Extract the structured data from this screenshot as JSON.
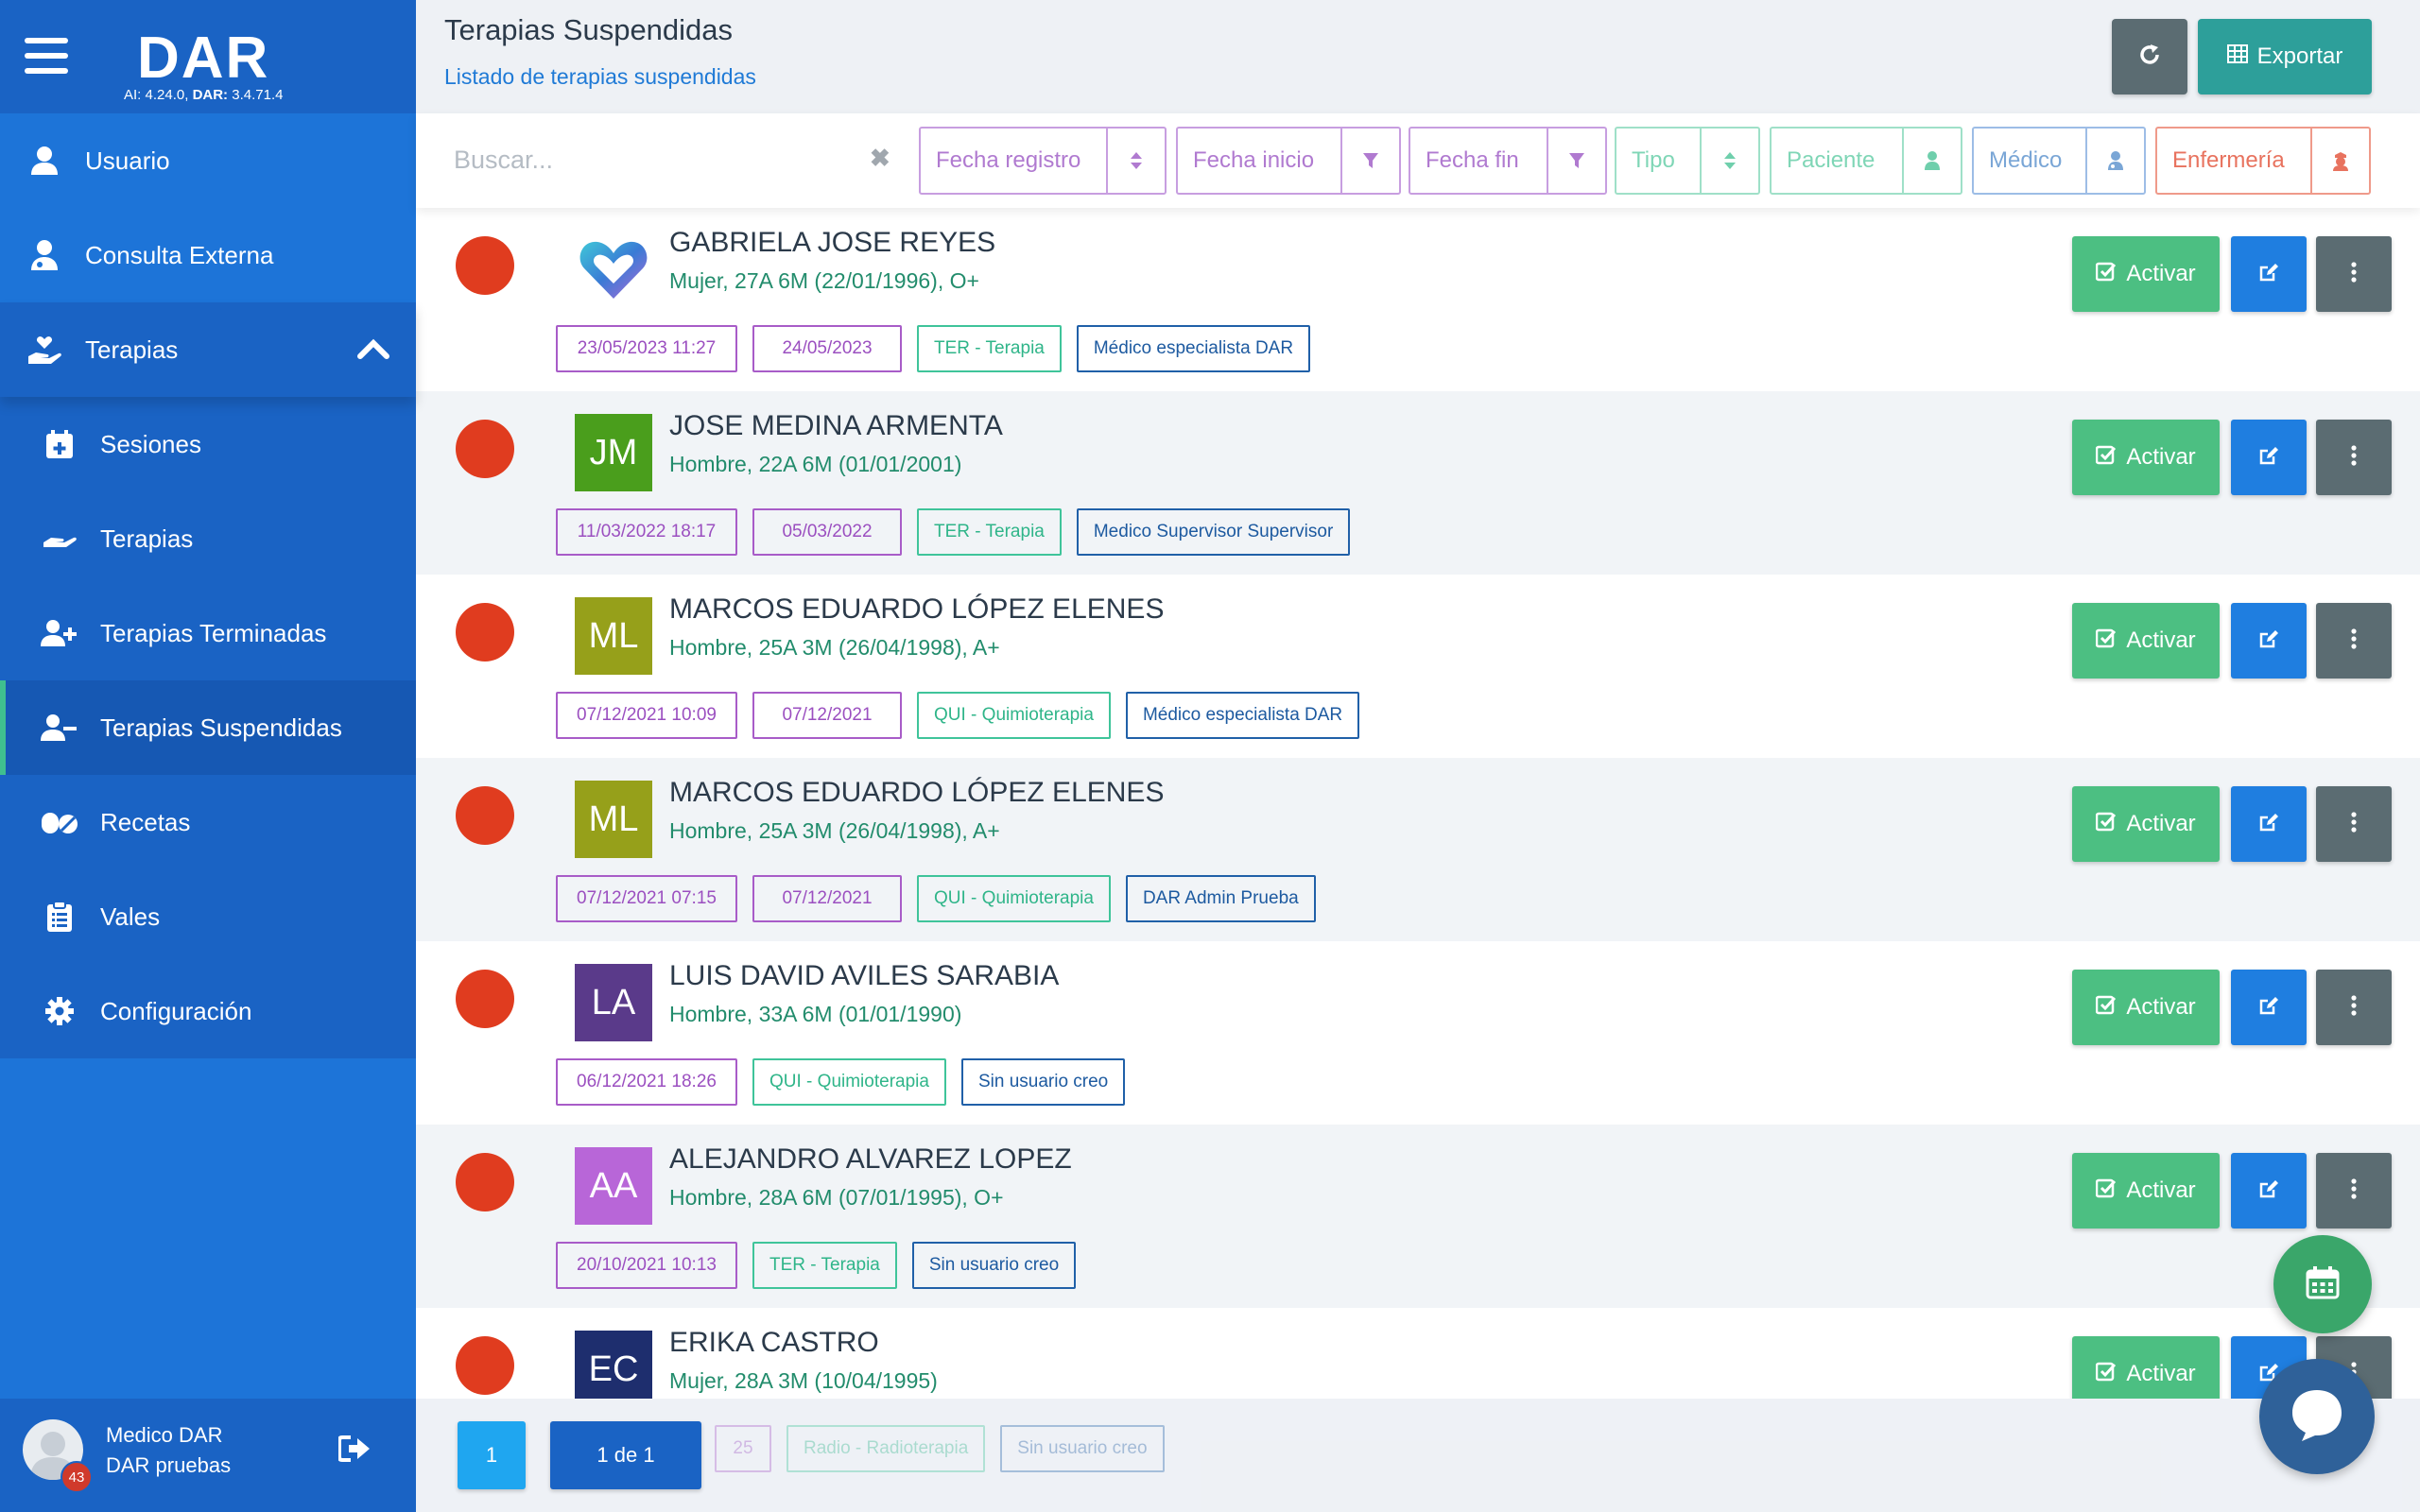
{
  "app": {
    "logo": "DAR",
    "version_ai_label": "AI:",
    "version_ai": "4.24.0,",
    "version_dar_label": "DAR:",
    "version_dar": "3.4.71.4"
  },
  "sidebar": {
    "items": [
      {
        "label": "Usuario",
        "icon": "user-icon"
      },
      {
        "label": "Consulta Externa",
        "icon": "doctor-icon"
      },
      {
        "label": "Terapias",
        "icon": "hand-heart-icon",
        "expanded": true
      },
      {
        "label": "Sesiones",
        "icon": "calendar-plus-icon"
      },
      {
        "label": "Terapias",
        "icon": "hand-icon"
      },
      {
        "label": "Terapias Terminadas",
        "icon": "user-plus-icon"
      },
      {
        "label": "Terapias Suspendidas",
        "icon": "user-minus-icon",
        "active": true
      },
      {
        "label": "Recetas",
        "icon": "pills-icon"
      },
      {
        "label": "Vales",
        "icon": "clipboard-icon"
      },
      {
        "label": "Configuración",
        "icon": "gear-icon"
      }
    ]
  },
  "user": {
    "name": "Medico DAR",
    "org": "DAR pruebas",
    "badge": "43"
  },
  "header": {
    "title": "Terapias Suspendidas",
    "subtitle": "Listado de terapias suspendidas",
    "export_label": "Exportar"
  },
  "filters": {
    "search_placeholder": "Buscar...",
    "clear": "✖",
    "items": [
      {
        "label": "Fecha registro",
        "icon": "sort-icon",
        "color": "#b07ad0"
      },
      {
        "label": "Fecha inicio",
        "icon": "filter-icon",
        "color": "#b07ad0"
      },
      {
        "label": "Fecha fin",
        "icon": "filter-icon",
        "color": "#b07ad0"
      },
      {
        "label": "Tipo",
        "icon": "sort-icon",
        "color": "#7fd6b6"
      },
      {
        "label": "Paciente",
        "icon": "patient-icon",
        "color": "#7fd6b6"
      },
      {
        "label": "Médico",
        "icon": "doctor-icon",
        "color": "#7aa6d6"
      },
      {
        "label": "Enfermería",
        "icon": "nurse-icon",
        "color": "#e8735f"
      }
    ]
  },
  "actions": {
    "activate_label": "Activar"
  },
  "patients": [
    {
      "name": "GABRIELA JOSE REYES",
      "info": "Mujer, 27A 6M (22/01/1996), O+",
      "initials": "",
      "avatar_color": "",
      "logo_avatar": true,
      "tags": [
        "23/05/2023 11:27",
        "24/05/2023",
        "TER - Terapia",
        "Médico especialista DAR"
      ]
    },
    {
      "name": "JOSE MEDINA ARMENTA",
      "info": "Hombre, 22A 6M (01/01/2001)",
      "initials": "JM",
      "avatar_color": "#4a9e1c",
      "tags": [
        "11/03/2022 18:17",
        "05/03/2022",
        "TER - Terapia",
        "Medico Supervisor Supervisor"
      ]
    },
    {
      "name": "MARCOS EDUARDO LÓPEZ ELENES",
      "info": "Hombre, 25A 3M (26/04/1998), A+",
      "initials": "ML",
      "avatar_color": "#96a01a",
      "tags": [
        "07/12/2021 10:09",
        "07/12/2021",
        "QUI - Quimioterapia",
        "Médico especialista DAR"
      ]
    },
    {
      "name": "MARCOS EDUARDO LÓPEZ ELENES",
      "info": "Hombre, 25A 3M (26/04/1998), A+",
      "initials": "ML",
      "avatar_color": "#96a01a",
      "tags": [
        "07/12/2021 07:15",
        "07/12/2021",
        "QUI - Quimioterapia",
        "DAR Admin Prueba"
      ]
    },
    {
      "name": "LUIS DAVID AVILES SARABIA",
      "info": "Hombre, 33A 6M (01/01/1990)",
      "initials": "LA",
      "avatar_color": "#5a3a8a",
      "tags": [
        "06/12/2021 18:26",
        "QUI - Quimioterapia",
        "Sin usuario creo"
      ]
    },
    {
      "name": "ALEJANDRO ALVAREZ LOPEZ",
      "info": "Hombre, 28A 6M (07/01/1995), O+",
      "initials": "AA",
      "avatar_color": "#b866d8",
      "tags": [
        "20/10/2021 10:13",
        "TER - Terapia",
        "Sin usuario creo"
      ]
    },
    {
      "name": "ERIKA CASTRO",
      "info": "Mujer, 28A 3M (10/04/1995)",
      "initials": "EC",
      "avatar_color": "#1e2e6e",
      "tags": [
        "25",
        "Radio - Radioterapia",
        "Sin usuario creo"
      ]
    }
  ],
  "pagination": {
    "current": "1",
    "summary": "1 de 1"
  }
}
